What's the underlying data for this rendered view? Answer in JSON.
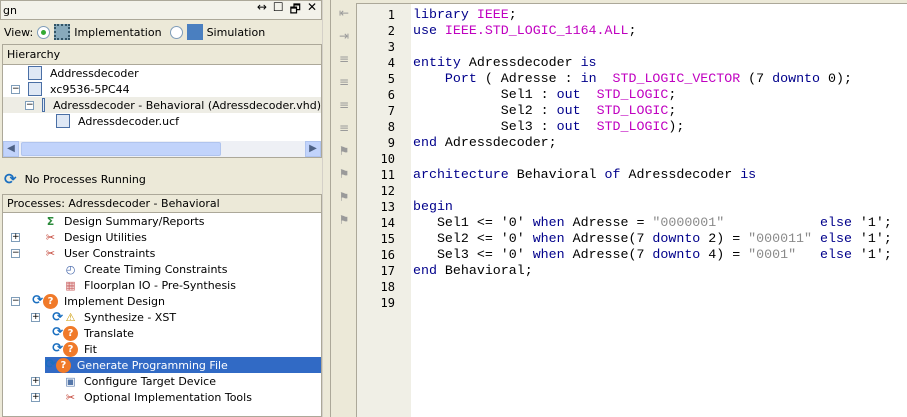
{
  "panel": {
    "title": "gn",
    "view_label": "View:",
    "impl_label": "Implementation",
    "sim_label": "Simulation",
    "ctrls": [
      "↔",
      "☐",
      "🗗",
      "✕"
    ]
  },
  "hierarchy": {
    "header": "Hierarchy",
    "items": [
      {
        "label": "Addressdecoder",
        "indent": 0,
        "exp": ""
      },
      {
        "label": "xc9536-5PC44",
        "indent": 0,
        "exp": "−"
      },
      {
        "label": "Adressdecoder - Behavioral (Adressdecoder.vhd)",
        "indent": 1,
        "exp": "−"
      },
      {
        "label": "Adressdecoder.ucf",
        "indent": 2,
        "exp": ""
      }
    ]
  },
  "status": "No Processes Running",
  "processes": {
    "header": "Processes: Adressdecoder - Behavioral",
    "items": [
      {
        "label": "Design Summary/Reports",
        "indent": 0,
        "exp": "",
        "icon": "sigma"
      },
      {
        "label": "Design Utilities",
        "indent": 0,
        "exp": "+",
        "icon": "tools"
      },
      {
        "label": "User Constraints",
        "indent": 0,
        "exp": "−",
        "icon": "tools"
      },
      {
        "label": "Create Timing Constraints",
        "indent": 1,
        "exp": "",
        "icon": "timing"
      },
      {
        "label": "Floorplan IO - Pre-Synthesis",
        "indent": 1,
        "exp": "",
        "icon": "grid"
      },
      {
        "label": "Implement Design",
        "indent": 0,
        "exp": "−",
        "icon": "question"
      },
      {
        "label": "Synthesize - XST",
        "indent": 1,
        "exp": "+",
        "icon": "warning"
      },
      {
        "label": "Translate",
        "indent": 1,
        "exp": "",
        "icon": "question"
      },
      {
        "label": "Fit",
        "indent": 1,
        "exp": "",
        "icon": "question"
      },
      {
        "label": "Generate Programming File",
        "indent": 1,
        "exp": "",
        "icon": "question",
        "selected": true
      },
      {
        "label": "Configure Target Device",
        "indent": 1,
        "exp": "+",
        "icon": "device"
      },
      {
        "label": "Optional Implementation Tools",
        "indent": 1,
        "exp": "+",
        "icon": "tools"
      }
    ]
  },
  "editor": {
    "lines": [
      [
        [
          "library ",
          "k"
        ],
        [
          "IEEE",
          "t"
        ],
        [
          ";",
          "p"
        ]
      ],
      [
        [
          "use ",
          "k"
        ],
        [
          "IEEE.STD_LOGIC_1164.ALL",
          "t"
        ],
        [
          ";",
          "p"
        ]
      ],
      [],
      [
        [
          "entity ",
          "k"
        ],
        [
          "Adressdecoder ",
          "p"
        ],
        [
          "is",
          "k"
        ]
      ],
      [
        [
          "    Port ",
          "k"
        ],
        [
          "( Adresse : ",
          "p"
        ],
        [
          "in",
          "k"
        ],
        [
          "  ",
          "p"
        ],
        [
          "STD_LOGIC_VECTOR",
          "t"
        ],
        [
          " (7 ",
          "p"
        ],
        [
          "downto",
          "k"
        ],
        [
          " 0);",
          "p"
        ]
      ],
      [
        [
          "           Sel1 : ",
          "p"
        ],
        [
          "out",
          "k"
        ],
        [
          "  ",
          "p"
        ],
        [
          "STD_LOGIC",
          "t"
        ],
        [
          ";",
          "p"
        ]
      ],
      [
        [
          "           Sel2 : ",
          "p"
        ],
        [
          "out",
          "k"
        ],
        [
          "  ",
          "p"
        ],
        [
          "STD_LOGIC",
          "t"
        ],
        [
          ";",
          "p"
        ]
      ],
      [
        [
          "           Sel3 : ",
          "p"
        ],
        [
          "out",
          "k"
        ],
        [
          "  ",
          "p"
        ],
        [
          "STD_LOGIC",
          "t"
        ],
        [
          ");",
          "p"
        ]
      ],
      [
        [
          "end ",
          "k"
        ],
        [
          "Adressdecoder;",
          "p"
        ]
      ],
      [],
      [
        [
          "architecture ",
          "k"
        ],
        [
          "Behavioral ",
          "p"
        ],
        [
          "of ",
          "k"
        ],
        [
          "Adressdecoder ",
          "p"
        ],
        [
          "is",
          "k"
        ]
      ],
      [],
      [
        [
          "begin",
          "k"
        ]
      ],
      [
        [
          "   Sel1 <= '0' ",
          "p"
        ],
        [
          "when ",
          "k"
        ],
        [
          "Adresse = ",
          "p"
        ],
        [
          "\"0000001\"",
          "s"
        ],
        [
          "            ",
          "p"
        ],
        [
          "else ",
          "k"
        ],
        [
          "'1';",
          "p"
        ]
      ],
      [
        [
          "   Sel2 <= '0' ",
          "p"
        ],
        [
          "when ",
          "k"
        ],
        [
          "Adresse(7 ",
          "p"
        ],
        [
          "downto ",
          "k"
        ],
        [
          "2) = ",
          "p"
        ],
        [
          "\"000011\"",
          "s"
        ],
        [
          " ",
          "p"
        ],
        [
          "else ",
          "k"
        ],
        [
          "'1';",
          "p"
        ]
      ],
      [
        [
          "   Sel3 <= '0' ",
          "p"
        ],
        [
          "when ",
          "k"
        ],
        [
          "Adresse(7 ",
          "p"
        ],
        [
          "downto ",
          "k"
        ],
        [
          "4) = ",
          "p"
        ],
        [
          "\"0001\"",
          "s"
        ],
        [
          "   ",
          "p"
        ],
        [
          "else ",
          "k"
        ],
        [
          "'1';",
          "p"
        ]
      ],
      [
        [
          "end ",
          "k"
        ],
        [
          "Behavioral;",
          "p"
        ]
      ],
      [],
      []
    ]
  }
}
